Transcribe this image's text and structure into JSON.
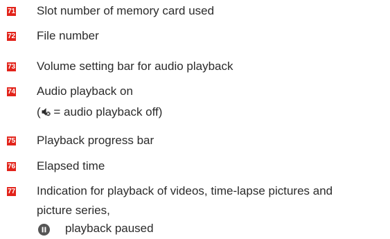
{
  "legend": [
    {
      "number": "71",
      "text": "Slot number of memory card used"
    },
    {
      "number": "72",
      "text": "File number"
    },
    {
      "number": "73",
      "text": "Volume setting bar for audio playback"
    },
    {
      "number": "74",
      "text": "Audio playback on",
      "subtext_before": "(",
      "subtext_after": " = audio playback off)",
      "subtext_icon": "speaker-mute-icon"
    },
    {
      "number": "75",
      "text": "Playback progress bar"
    },
    {
      "number": "76",
      "text": "Elapsed time"
    },
    {
      "number": "77",
      "text": "Indication for playback of videos, time-lapse pictures and",
      "text_line2": "picture series,",
      "subitem_icon": "pause-icon",
      "subitem_text": "playback paused"
    }
  ],
  "colors": {
    "badge": "#e2231a",
    "text": "#2b2b2b",
    "icon": "#555555"
  }
}
